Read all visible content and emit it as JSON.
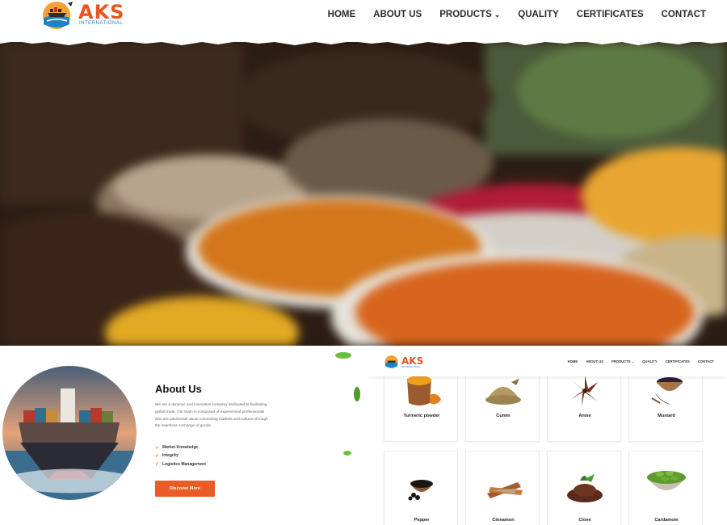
{
  "brand": {
    "name": "AKS",
    "tagline": "INTERNATIONAL"
  },
  "nav": {
    "items": [
      {
        "label": "HOME"
      },
      {
        "label": "ABOUT US"
      },
      {
        "label": "PRODUCTS",
        "has_dropdown": true
      },
      {
        "label": "QUALITY"
      },
      {
        "label": "CERTIFICATES"
      },
      {
        "label": "CONTACT"
      }
    ],
    "dropdown_icon": "chevron-down-icon"
  },
  "hero": {
    "image": "blurred bowls of colorful spice powders"
  },
  "about": {
    "title": "About Us",
    "text": "We are a dynamic and innovative company dedicated to facilitating global trade. Our team is composed of experienced professionals who are passionate about connecting markets and cultures through the seamless exchange of goods.",
    "bullets": [
      "Market Knowledge",
      "Integrity",
      "Logistics Management"
    ],
    "bullet_icon": "checkmark-icon",
    "button_label": "Discover More"
  },
  "product_page": {
    "brand": {
      "name": "AKS",
      "tagline": "INTERNATIONAL"
    },
    "nav": [
      "HOME",
      "ABOUT US",
      "PRODUCTS",
      "QUALITY",
      "CERTIFICATES",
      "CONTACT"
    ],
    "products": [
      {
        "name": "Turmeric powder"
      },
      {
        "name": "Cumin"
      },
      {
        "name": "Anise"
      },
      {
        "name": "Mustard"
      },
      {
        "name": "Pepper"
      },
      {
        "name": "Cinnamon"
      },
      {
        "name": "Clove"
      },
      {
        "name": "Cardamom"
      }
    ]
  },
  "colors": {
    "accent": "#EA5B25",
    "brand_blue": "#1D84C4",
    "text": "#2B2B2B"
  }
}
